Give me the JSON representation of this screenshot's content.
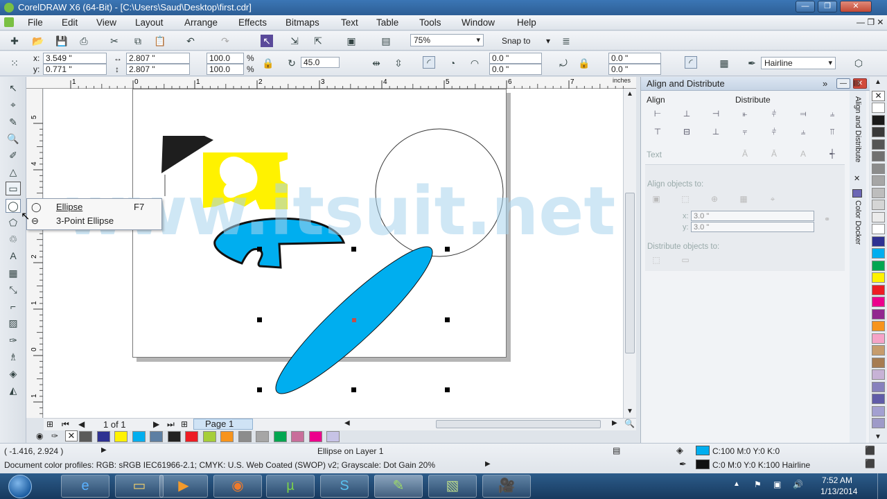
{
  "window": {
    "title": "CorelDRAW X6 (64-Bit) - [C:\\Users\\Saud\\Desktop\\first.cdr]"
  },
  "menu": [
    "File",
    "Edit",
    "View",
    "Layout",
    "Arrange",
    "Effects",
    "Bitmaps",
    "Text",
    "Table",
    "Tools",
    "Window",
    "Help"
  ],
  "standard_toolbar": {
    "zoom": "75%",
    "snap": "Snap to"
  },
  "property_bar": {
    "x_label": "x:",
    "x_value": "3.549 \"",
    "y_label": "y:",
    "y_value": "0.771 \"",
    "width": "2.807 \"",
    "height": "2.807 \"",
    "scale_x": "100.0",
    "scale_y": "100.0",
    "pct": "%",
    "rotation": "45.0",
    "start_angle": "0.0 \"",
    "end_angle": "0.0 \"",
    "corner_a": "0.0 \"",
    "corner_b": "0.0 \"",
    "outline": "Hairline"
  },
  "ruler": {
    "unit": "inches",
    "top_ticks": [
      "1",
      "0",
      "1",
      "2",
      "3",
      "4",
      "5",
      "6",
      "7"
    ],
    "left_ticks": [
      "5",
      "4",
      "3",
      "2",
      "1",
      "0",
      "1"
    ]
  },
  "flyout": {
    "items": [
      {
        "label": "Ellipse",
        "shortcut": "F7"
      },
      {
        "label": "3-Point Ellipse",
        "shortcut": ""
      }
    ]
  },
  "watermark": "www.itsuit.net",
  "page_nav": {
    "counter": "1 of 1",
    "tab": "Page 1"
  },
  "docker": {
    "title": "Align and Distribute",
    "align": "Align",
    "distribute": "Distribute",
    "text": "Text",
    "align_to": "Align objects to:",
    "x_label": "x:",
    "x_value": "3.0 \"",
    "y_label": "y:",
    "y_value": "3.0 \"",
    "distribute_to": "Distribute objects to:",
    "tab_align": "Align and Distribute",
    "tab_color": "Color Docker"
  },
  "palette_right": [
    "#ffffff",
    "#1a1a1a",
    "#3a3a3a",
    "#555555",
    "#707070",
    "#8c8c8c",
    "#a6a6a6",
    "#bdbdbd",
    "#d5d5d5",
    "#ebebeb",
    "#ffffff",
    "#2e3192",
    "#00aeef",
    "#00a651",
    "#fff200",
    "#ed1c24",
    "#ec008c",
    "#92278f",
    "#f7941d",
    "#f5a3c7",
    "#c69c6d",
    "#a67c52",
    "#c7b2d6",
    "#8781bd",
    "#605ca8",
    "#a3a0d1",
    "#9e9ac8"
  ],
  "palette_bottom": [
    "#5a5a5a",
    "#2e3192",
    "#fff200",
    "#00aeef",
    "#5d7fa3",
    "#222222",
    "#ed1c24",
    "#a6ce39",
    "#f7941d",
    "#8c8c8c",
    "#a6a6a6",
    "#00a651",
    "#c86e9b",
    "#ec008c",
    "#c7c3e6"
  ],
  "status": {
    "coords": "( -1.416, 2.924 )",
    "object": "Ellipse on Layer 1",
    "profiles": "Document color profiles: RGB: sRGB IEC61966-2.1; CMYK: U.S. Web Coated (SWOP) v2; Grayscale: Dot Gain 20%",
    "fill": "C:100 M:0 Y:0 K:0",
    "outline": "C:0 M:0 Y:0 K:100  Hairline",
    "fill_color": "#00aeef",
    "outline_color": "#111111"
  },
  "taskbar": {
    "time": "7:52 AM",
    "date": "1/13/2014"
  }
}
